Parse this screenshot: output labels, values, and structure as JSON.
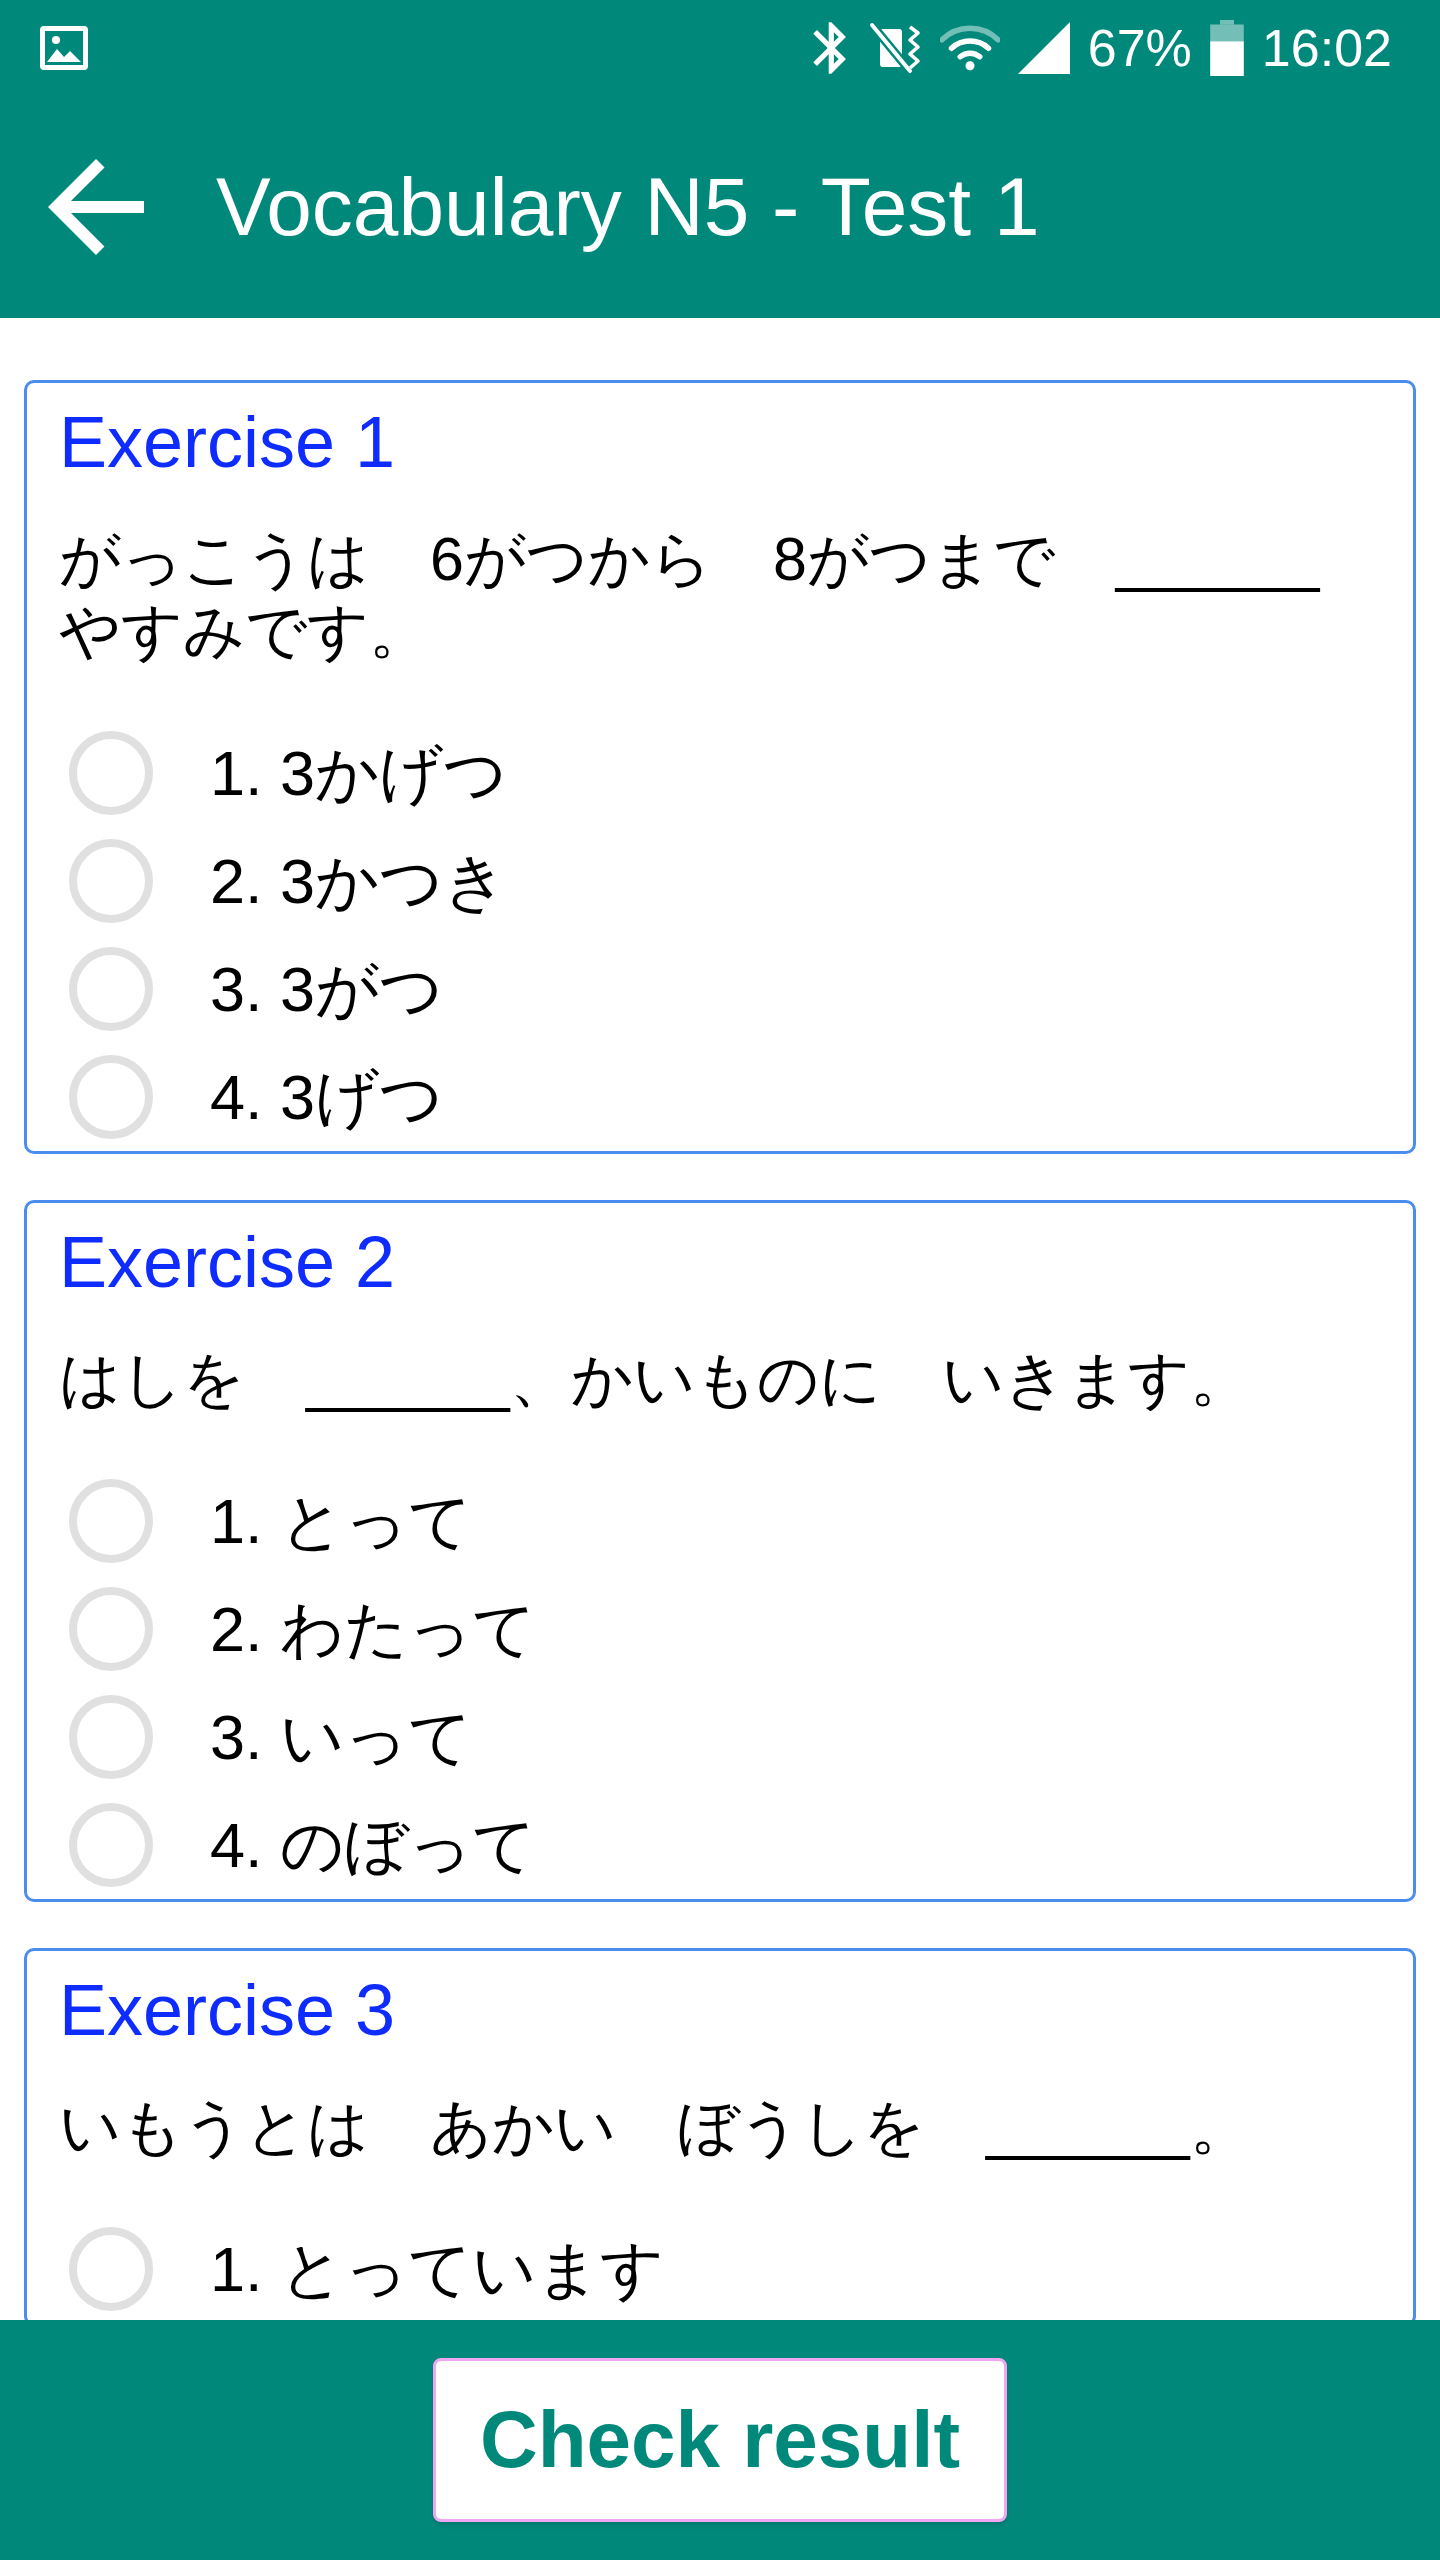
{
  "status_bar": {
    "battery": "67%",
    "time": "16:02"
  },
  "app_bar": {
    "title": "Vocabulary N5 - Test 1"
  },
  "exercises": [
    {
      "title": "Exercise 1",
      "question": "がっこうは　6がつから　8がつまで　______　やすみです。",
      "options": [
        {
          "label": "1. 3かげつ",
          "selected": false
        },
        {
          "label": "2. 3かつき",
          "selected": false
        },
        {
          "label": "3. 3がつ",
          "selected": false
        },
        {
          "label": "4. 3げつ",
          "selected": false
        }
      ]
    },
    {
      "title": "Exercise 2",
      "question": "はしを　______、かいものに　いきます。",
      "options": [
        {
          "label": "1. とって",
          "selected": false
        },
        {
          "label": "2. わたって",
          "selected": false
        },
        {
          "label": "3. いって",
          "selected": false
        },
        {
          "label": "4. のぼって",
          "selected": false
        }
      ]
    },
    {
      "title": "Exercise 3",
      "question": "いもうとは　あかい　ぼうしを　______。",
      "options": [
        {
          "label": "1. とっています",
          "selected": false
        }
      ]
    }
  ],
  "footer": {
    "button": "Check result"
  }
}
